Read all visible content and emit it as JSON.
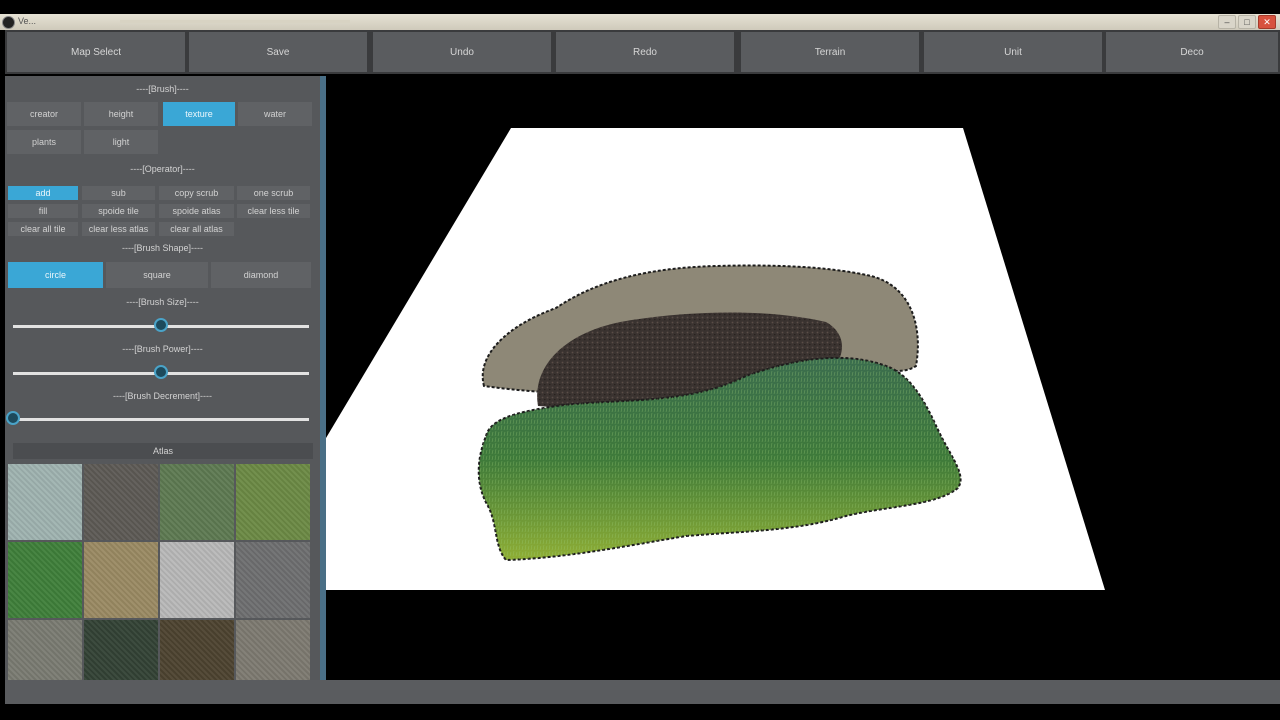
{
  "window": {
    "title": "Ve...",
    "controls": [
      "–",
      "□",
      "✕"
    ]
  },
  "toolbar": {
    "buttons": [
      {
        "label": "Map Select"
      },
      {
        "label": "Save"
      },
      {
        "label": "Undo"
      },
      {
        "label": "Redo"
      },
      {
        "label": "Terrain"
      },
      {
        "label": "Unit"
      },
      {
        "label": "Deco"
      }
    ]
  },
  "panel": {
    "brush_header": "----[Brush]----",
    "brush_tabs": [
      {
        "label": "creator",
        "active": false
      },
      {
        "label": "height",
        "active": false
      },
      {
        "label": "texture",
        "active": true
      },
      {
        "label": "water",
        "active": false
      },
      {
        "label": "plants",
        "active": false
      },
      {
        "label": "light",
        "active": false
      }
    ],
    "operator_header": "----[Operator]----",
    "operators": [
      {
        "label": "add",
        "active": true
      },
      {
        "label": "sub",
        "active": false
      },
      {
        "label": "copy scrub",
        "active": false
      },
      {
        "label": "one scrub",
        "active": false
      },
      {
        "label": "fill",
        "active": false
      },
      {
        "label": "spoide tile",
        "active": false
      },
      {
        "label": "spoide atlas",
        "active": false
      },
      {
        "label": "clear less tile",
        "active": false
      },
      {
        "label": "clear all tile",
        "active": false
      },
      {
        "label": "clear less atlas",
        "active": false
      },
      {
        "label": "clear all atlas",
        "active": false
      }
    ],
    "shape_header": "----[Brush Shape]----",
    "shapes": [
      {
        "label": "circle",
        "active": true
      },
      {
        "label": "square",
        "active": false
      },
      {
        "label": "diamond",
        "active": false
      }
    ],
    "size_header": "----[Brush Size]----",
    "brush_size_level": 0.5,
    "power_header": "----[Brush Power]----",
    "brush_power_level": 0.5,
    "decrement_header": "----[Brush Decrement]----",
    "brush_decrement_level": 0.0,
    "atlas_label": "Atlas",
    "atlas_tiles": [
      {
        "name": "pale-water-texture",
        "color": "#9fb3b0"
      },
      {
        "name": "gravel-texture",
        "color": "#5d5a55"
      },
      {
        "name": "mossy-grass-texture",
        "color": "#5e7a52"
      },
      {
        "name": "green-grass-texture",
        "color": "#6c8a45"
      },
      {
        "name": "bright-grass-texture",
        "color": "#3f7f3a"
      },
      {
        "name": "sand-texture",
        "color": "#9a8a63"
      },
      {
        "name": "snow-texture",
        "color": "#b8b8b8"
      },
      {
        "name": "stone-texture",
        "color": "#6e6f70"
      },
      {
        "name": "rock-texture",
        "color": "#7a7b72"
      },
      {
        "name": "dark-grass-texture",
        "color": "#334235"
      },
      {
        "name": "dirt-texture",
        "color": "#4d4330"
      },
      {
        "name": "pebble-texture",
        "color": "#7d7a71"
      }
    ]
  },
  "colors": {
    "accent": "#3aa7d6",
    "panel": "#56585b",
    "button": "#606265"
  }
}
